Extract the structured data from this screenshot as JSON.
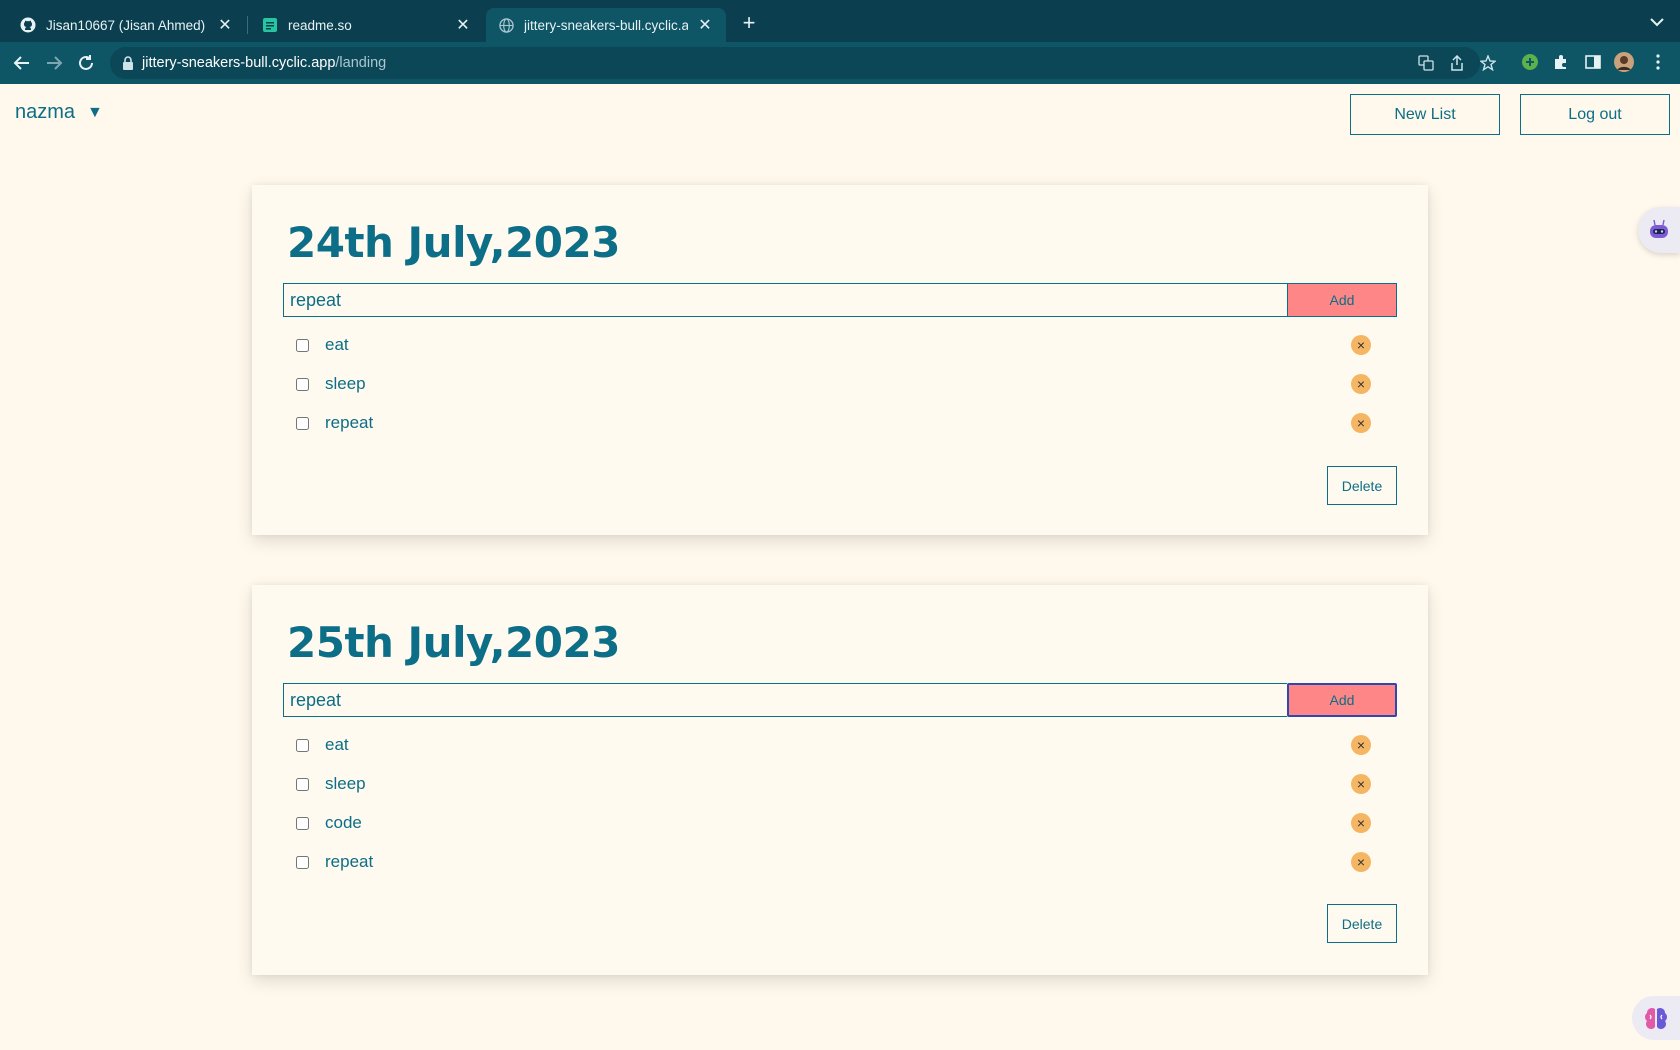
{
  "browser": {
    "tabs": [
      {
        "title": "Jisan10667 (Jisan Ahmed)",
        "icon": "github-icon",
        "active": false
      },
      {
        "title": "readme.so",
        "icon": "readme-icon",
        "active": false
      },
      {
        "title": "jittery-sneakers-bull.cyclic.app",
        "icon": "globe-icon",
        "active": true
      }
    ],
    "url_host": "jittery-sneakers-bull.cyclic.app",
    "url_path": "/landing"
  },
  "header": {
    "username": "nazma",
    "caret": "▼",
    "new_list_label": "New List",
    "logout_label": "Log out"
  },
  "lists": [
    {
      "date": "24th July,2023",
      "input_value": "repeat",
      "add_label": "Add",
      "items": [
        "eat",
        "sleep",
        "repeat"
      ],
      "delete_label": "Delete"
    },
    {
      "date": "25th July,2023",
      "input_value": "repeat",
      "add_label": "Add",
      "items": [
        "eat",
        "sleep",
        "code",
        "repeat"
      ],
      "delete_label": "Delete"
    }
  ],
  "colors": {
    "primary": "#0d6e87",
    "background": "#fff8ec",
    "add_button": "#ff8686",
    "remove_badge": "#f5b664"
  }
}
